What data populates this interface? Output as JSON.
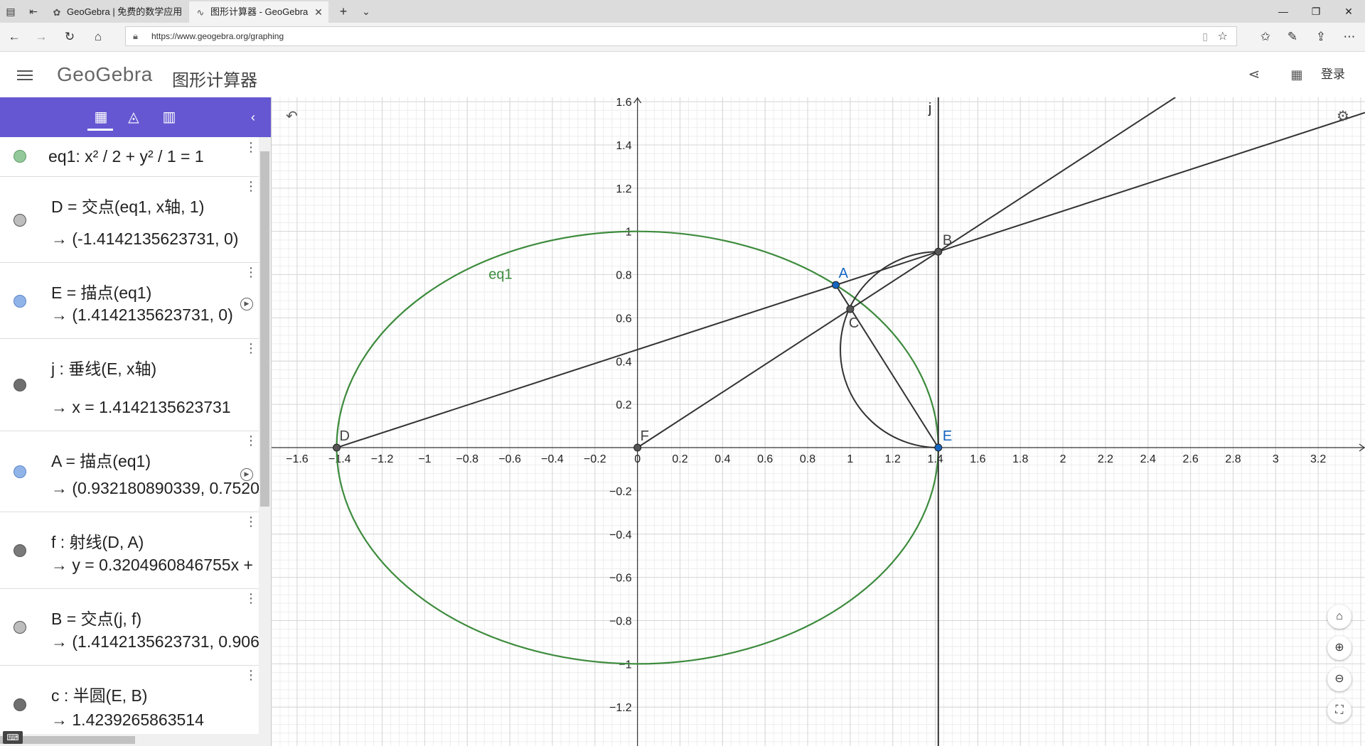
{
  "browser": {
    "tabs": [
      {
        "title": "GeoGebra | 免费的数学应用",
        "icon": "geogebra-icon"
      },
      {
        "title": "图形计算器 - GeoGebra",
        "icon": "graph-icon"
      }
    ],
    "url": "https://www.geogebra.org/graphing",
    "new_tab_symbol": "+",
    "tab_list_symbol": "⌄"
  },
  "header": {
    "logo": "GeoGebra",
    "app_title": "图形计算器",
    "login": "登录"
  },
  "algebra": {
    "items": [
      {
        "def": "eq1: x² / 2 + y² / 1 = 1",
        "value": "",
        "color": "#93c99a"
      },
      {
        "def": "D = 交点(eq1, x轴, 1)",
        "value": "→ (-1.4142135623731, 0)",
        "color": "#bdbdbd"
      },
      {
        "def": "E = 描点(eq1)",
        "value": "→ (1.4142135623731, 0)",
        "color": "#90b4e8"
      },
      {
        "def": "j : 垂线(E, x轴)",
        "value": "→ x = 1.4142135623731",
        "color": "#6f6f6f"
      },
      {
        "def": "A = 描点(eq1)",
        "value": "→ (0.932180890339, 0.7520",
        "color": "#90b4e8"
      },
      {
        "def": "f : 射线(D, A)",
        "value": "→ y = 0.3204960846755x +",
        "color": "#7a7a7a"
      },
      {
        "def": "B = 交点(j, f)",
        "value": "→ (1.4142135623731, 0.906",
        "color": "#bdbdbd"
      },
      {
        "def": "c : 半圆(E, B)",
        "value": "→ 1.4239265863514",
        "color": "#6f6f6f"
      }
    ]
  },
  "chart_data": {
    "type": "scatter",
    "xlim": [
      -1.72,
      3.42
    ],
    "ylim": [
      -1.38,
      1.62
    ],
    "x_ticks": [
      "−1.6",
      "−1.4",
      "−1.2",
      "−1",
      "−0.8",
      "−0.6",
      "−0.4",
      "−0.2",
      "0",
      "0.2",
      "0.4",
      "0.6",
      "0.8",
      "1",
      "1.2",
      "1.4",
      "1.6",
      "1.8",
      "2",
      "2.2",
      "2.4",
      "2.6",
      "2.8",
      "3",
      "3.2"
    ],
    "y_ticks": [
      "1.6",
      "1.4",
      "1.2",
      "1",
      "0.8",
      "0.6",
      "0.4",
      "0.2",
      "−0.2",
      "−0.4",
      "−0.6",
      "−0.8",
      "−1",
      "−1.2"
    ],
    "grid": true,
    "ellipse": {
      "label": "eq1",
      "a": 1.4142135623731,
      "b": 1,
      "color": "#3d8b3d"
    },
    "points": [
      {
        "name": "D",
        "x": -1.4142135623731,
        "y": 0,
        "color": "#555555"
      },
      {
        "name": "E",
        "x": 1.4142135623731,
        "y": 0,
        "color": "#1565c0"
      },
      {
        "name": "A",
        "x": 0.932180890339,
        "y": 0.752,
        "color": "#1565c0"
      },
      {
        "name": "B",
        "x": 1.4142135623731,
        "y": 0.906,
        "color": "#555555"
      },
      {
        "name": "F",
        "x": 0,
        "y": 0,
        "color": "#555555"
      },
      {
        "name": "C",
        "x": 1.0,
        "y": 0.641,
        "color": "#555555"
      }
    ],
    "vertical_line": {
      "name": "j",
      "x": 1.4142135623731
    },
    "ray_f": {
      "from": "D",
      "slope": 0.3204960846755
    },
    "ray_FB": {
      "from": "F",
      "through": "B"
    },
    "segment_AE": {
      "from": "A",
      "to": "E"
    },
    "semicircle": {
      "from": "E",
      "to": "B"
    }
  }
}
